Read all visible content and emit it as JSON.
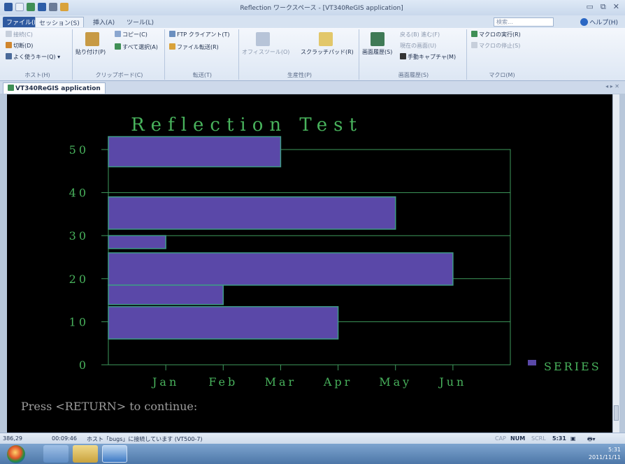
{
  "window": {
    "title": "Reflection ワークスペース - [VT340ReGIS application]"
  },
  "menu": {
    "tabs": [
      "ファイル(F)",
      "セッション(S)",
      "挿入(A)",
      "ツール(L)"
    ],
    "search_placeholder": "検索...",
    "help_label": "ヘルプ(H)"
  },
  "ribbon": {
    "host_group": {
      "items": [
        "接続(C)",
        "切断(D)",
        "よく使うキー(Q)"
      ],
      "label": "ホスト(H)"
    },
    "clipboard_group": {
      "paste": "貼り付け(P)",
      "copy": "コピー(C)",
      "select_all": "すべて選択(A)",
      "label": "クリップボード(C)"
    },
    "transfer_group": {
      "ftp": "FTP クライアント(T)",
      "file_transfer": "ファイル転送(R)",
      "label": "転送(T)"
    },
    "productivity_group": {
      "office_tools": "オフィスツール(O)",
      "scratchpad": "スクラッチパッド(R)",
      "label": "生産性(P)"
    },
    "screen_history_group": {
      "history": "画面履歴(S)",
      "back": "戻る(B)",
      "forward": "進む(F)",
      "current": "現在の画面(U)",
      "manual_capture": "手動キャプチャ(M)",
      "label": "画面履歴(S)"
    },
    "macro_group": {
      "run": "マクロの実行(R)",
      "stop": "マクロの停止(S)",
      "label": "マクロ(M)"
    }
  },
  "document": {
    "tab_label": "VT340ReGIS application",
    "controls": "◂ ▸ ✕"
  },
  "terminal": {
    "prompt": "Press <RETURN> to continue:",
    "colors": {
      "background": "#000000",
      "text": "#48b25c",
      "bar_fill": "#5a48a8",
      "bar_stroke": "#3e9a86",
      "grid": "#3e9a5c"
    }
  },
  "chart_data": {
    "type": "bar",
    "orientation": "horizontal",
    "title": "Reflection Test",
    "series": [
      {
        "name": "SERIES",
        "color": "#5a48a8"
      }
    ],
    "bars": [
      {
        "y_from": 46,
        "y_to": 53,
        "value": "Mar"
      },
      {
        "y_from": 31.5,
        "y_to": 39,
        "value": "May"
      },
      {
        "y_from": 27,
        "y_to": 30,
        "value": "Jan"
      },
      {
        "y_from": 18.5,
        "y_to": 26,
        "value": "Jun"
      },
      {
        "y_from": 14,
        "y_to": 18.5,
        "value": "Feb"
      },
      {
        "y_from": 6,
        "y_to": 13.5,
        "value": "Apr"
      }
    ],
    "x_categories": [
      "Jan",
      "Feb",
      "Mar",
      "Apr",
      "May",
      "Jun"
    ],
    "y_ticks": [
      "0",
      "10",
      "20",
      "30",
      "40",
      "50"
    ],
    "ylim": [
      0,
      50
    ],
    "grid": true,
    "legend_position": "right"
  },
  "statusbar": {
    "cursor_position": "386,29",
    "elapsed": "00:09:46",
    "connection_status": "ホスト「bugs」に接続しています (VT500-7)",
    "caps": "CAP",
    "num": "NUM",
    "scroll": "SCRL",
    "time": "5:31"
  },
  "taskbar": {
    "clock_time": "5:31",
    "clock_date": "2011/11/11"
  }
}
